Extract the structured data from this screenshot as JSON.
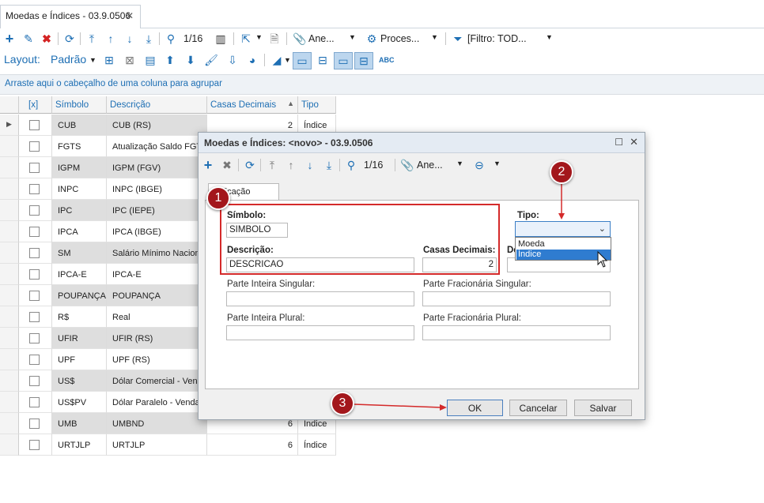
{
  "window": {
    "tab_title": "Moedas e Índices - 03.9.0506",
    "tab_close": "✕"
  },
  "toolbar": {
    "page_indicator": "1/16",
    "anexos_label": "Ane...",
    "processos_label": "Proces...",
    "filter_label": "[Filtro: TOD..."
  },
  "layoutbar": {
    "layout_label": "Layout:",
    "layout_value": "Padrão"
  },
  "groupbar": {
    "hint": "Arraste aqui o cabeçalho de uma coluna para agrupar"
  },
  "grid": {
    "columns": [
      "[x]",
      "Símbolo",
      "Descrição",
      "Casas Decimais",
      "Tipo"
    ],
    "rows": [
      {
        "simbolo": "CUB",
        "descricao": "CUB (RS)",
        "casas": "2",
        "tipo": "Índice"
      },
      {
        "simbolo": "FGTS",
        "descricao": "Atualização Saldo FGT",
        "casas": "",
        "tipo": ""
      },
      {
        "simbolo": "IGPM",
        "descricao": "IGPM (FGV)",
        "casas": "",
        "tipo": ""
      },
      {
        "simbolo": "INPC",
        "descricao": "INPC (IBGE)",
        "casas": "",
        "tipo": ""
      },
      {
        "simbolo": "IPC",
        "descricao": "IPC (IEPE)",
        "casas": "",
        "tipo": ""
      },
      {
        "simbolo": "IPCA",
        "descricao": "IPCA (IBGE)",
        "casas": "",
        "tipo": ""
      },
      {
        "simbolo": "SM",
        "descricao": "Salário Mínimo Naciona",
        "casas": "",
        "tipo": ""
      },
      {
        "simbolo": "IPCA-E",
        "descricao": "IPCA-E",
        "casas": "",
        "tipo": ""
      },
      {
        "simbolo": "POUPANÇA",
        "descricao": "POUPANÇA",
        "casas": "",
        "tipo": ""
      },
      {
        "simbolo": "R$",
        "descricao": "Real",
        "casas": "",
        "tipo": ""
      },
      {
        "simbolo": "UFIR",
        "descricao": "UFIR (RS)",
        "casas": "",
        "tipo": ""
      },
      {
        "simbolo": "UPF",
        "descricao": "UPF (RS)",
        "casas": "",
        "tipo": ""
      },
      {
        "simbolo": "US$",
        "descricao": "Dólar Comercial - Ven.",
        "casas": "",
        "tipo": ""
      },
      {
        "simbolo": "US$PV",
        "descricao": "Dólar Paralelo - Venda",
        "casas": "",
        "tipo": ""
      },
      {
        "simbolo": "UMB",
        "descricao": "UMBND",
        "casas": "6",
        "tipo": "Índice"
      },
      {
        "simbolo": "URTJLP",
        "descricao": "URTJLP",
        "casas": "6",
        "tipo": "Índice"
      }
    ]
  },
  "dialog": {
    "title": "Moedas e Índices: <novo> - 03.9.0506",
    "page_indicator": "1/16",
    "anexos_label": "Ane...",
    "tab_label": "ntificação",
    "simbolo_label": "Símbolo:",
    "simbolo_value": "SIMBOLO",
    "tipo_label": "Tipo:",
    "descricao_label": "Descrição:",
    "descricao_value": "DESCRICAO",
    "casas_label": "Casas Decimais:",
    "casas_value": "2",
    "de_label": "De",
    "parte_inteira_singular": "Parte Inteira Singular:",
    "parte_fracionaria_singular": "Parte Fracionária Singular:",
    "parte_inteira_plural": "Parte Inteira Plural:",
    "parte_fracionaria_plural": "Parte Fracionária Plural:",
    "tipo_options": [
      "Moeda",
      "Índice"
    ],
    "tipo_highlighted": "Índice",
    "ok_label": "OK",
    "cancel_label": "Cancelar",
    "save_label": "Salvar"
  },
  "annotations": {
    "badge1": "1",
    "badge2": "2",
    "badge3": "3",
    "color": "#a3171c"
  }
}
